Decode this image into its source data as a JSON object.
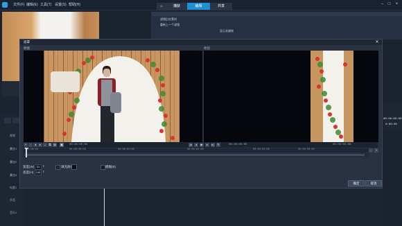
{
  "menu": [
    "文件(F)",
    "编辑(E)",
    "工具(T)",
    "设置(S)",
    "帮助(H)"
  ],
  "tabs": {
    "home": "⌂",
    "capture": "捕获",
    "edit": "编辑",
    "share": "共享"
  },
  "right_panel": {
    "header": "",
    "row1": "滤镜后在素材",
    "row2": "重新上一个滤镜",
    "row3": "显示关键帧"
  },
  "dialog": {
    "title": "遮罩",
    "close": "✕",
    "original_label": "原图",
    "trimmed_label": "修剪",
    "timecodes": [
      "00:00:00:00",
      "00:00:00:00",
      "00:00:00:00"
    ],
    "ruler": [
      "00:00:00",
      "00:00:00:08",
      "00:00:01:00",
      "00:00:02:00",
      "00:00:02:08",
      "00:00:03:00"
    ],
    "width_label": "宽度(W)",
    "width_value": "31",
    "height_label": "高度(H)",
    "height_value": "100",
    "fill_label": "填充颜色",
    "fill_checked": "✓",
    "blur_label": "模糊(B)",
    "ok": "确定",
    "cancel": "取消"
  },
  "right_edge": {
    "timecode": "00:00:00:00",
    "value": "0:00:00"
  },
  "tracks": [
    "视频",
    "叠加1",
    "叠加2",
    "叠加3",
    "标题1",
    "声音",
    "音乐1"
  ],
  "colors": {
    "accent": "#1f8fd1",
    "panel": "#2a3242",
    "bg": "#1b2230"
  }
}
